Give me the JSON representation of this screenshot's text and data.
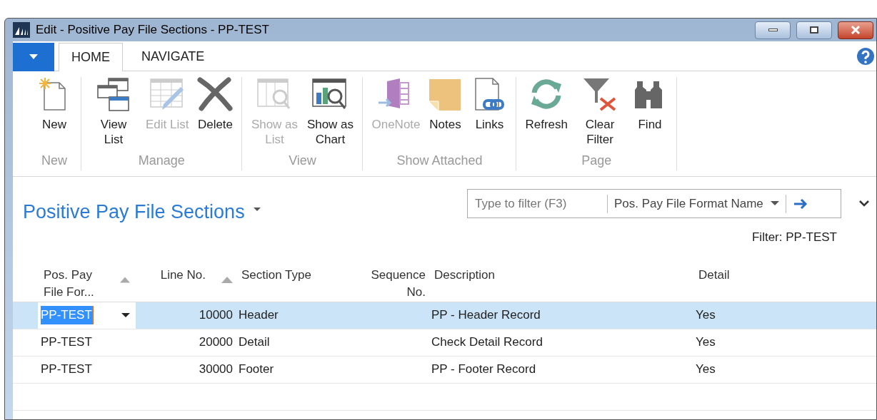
{
  "window": {
    "title": "Edit - Positive Pay File Sections - PP-TEST"
  },
  "ribbon_tabs": [
    {
      "label": "HOME",
      "selected": true
    },
    {
      "label": "NAVIGATE",
      "selected": false
    }
  ],
  "ribbon_groups": [
    {
      "label": "New",
      "buttons": [
        {
          "label": "New",
          "disabled": false
        }
      ]
    },
    {
      "label": "Manage",
      "buttons": [
        {
          "label": "View List",
          "disabled": false
        },
        {
          "label": "Edit List",
          "disabled": true
        },
        {
          "label": "Delete",
          "disabled": false
        }
      ]
    },
    {
      "label": "View",
      "buttons": [
        {
          "label": "Show as List",
          "disabled": true
        },
        {
          "label": "Show as Chart",
          "disabled": false
        }
      ]
    },
    {
      "label": "Show Attached",
      "buttons": [
        {
          "label": "OneNote",
          "disabled": true
        },
        {
          "label": "Notes",
          "disabled": false
        },
        {
          "label": "Links",
          "disabled": false
        }
      ]
    },
    {
      "label": "Page",
      "buttons": [
        {
          "label": "Refresh",
          "disabled": false
        },
        {
          "label": "Clear Filter",
          "disabled": false
        },
        {
          "label": "Find",
          "disabled": false
        }
      ]
    }
  ],
  "page": {
    "title": "Positive Pay File Sections",
    "filter": {
      "placeholder": "Type to filter (F3)",
      "field": "Pos. Pay File Format Name"
    },
    "filter_text": "Filter: PP-TEST"
  },
  "table": {
    "columns": [
      {
        "label": "Pos. Pay File For...",
        "numeric": false,
        "sorted": true
      },
      {
        "label": "Line No.",
        "numeric": true,
        "sorted": true
      },
      {
        "label": "Section Type",
        "numeric": false,
        "sorted": false
      },
      {
        "label": "Sequence No.",
        "numeric": true,
        "sorted": false
      },
      {
        "label": "Description",
        "numeric": false,
        "sorted": false
      },
      {
        "label": "Detail",
        "numeric": false,
        "sorted": false
      }
    ],
    "rows": [
      {
        "selected": true,
        "cells": [
          "PP-TEST",
          "10000",
          "Header",
          "",
          "PP - Header Record",
          "Yes"
        ]
      },
      {
        "selected": false,
        "cells": [
          "PP-TEST",
          "20000",
          "Detail",
          "",
          "Check Detail Record",
          "Yes"
        ]
      },
      {
        "selected": false,
        "cells": [
          "PP-TEST",
          "30000",
          "Footer",
          "",
          "PP - Footer Record",
          "Yes"
        ]
      }
    ]
  }
}
